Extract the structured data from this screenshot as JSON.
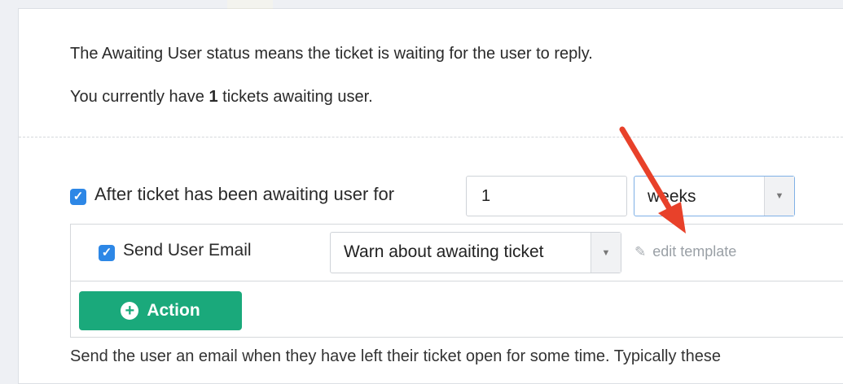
{
  "intro": {
    "status_text": "The Awaiting User status means the ticket is waiting for the user to reply.",
    "count_prefix": "You currently have ",
    "count": "1",
    "count_suffix": " tickets awaiting user."
  },
  "trigger": {
    "label": "After ticket has been awaiting user for",
    "amount": "1",
    "unit": "weeks",
    "checked": true
  },
  "action": {
    "send_label": "Send User Email",
    "template": "Warn about awaiting ticket",
    "edit_template_label": "edit template",
    "add_button_label": "Action",
    "checked": true
  },
  "footer": {
    "description": "Send the user an email when they have left their ticket open for some time. Typically these"
  },
  "colors": {
    "checkbox": "#2d87e6",
    "action_button": "#1aa97b",
    "annotation_arrow": "#e8412a"
  },
  "icons": {
    "checkbox": "checkmark-icon",
    "dropdown": "chevron-down-icon",
    "edit": "pencil-icon",
    "add": "plus-circle-icon",
    "annotation": "red-arrow-icon"
  }
}
